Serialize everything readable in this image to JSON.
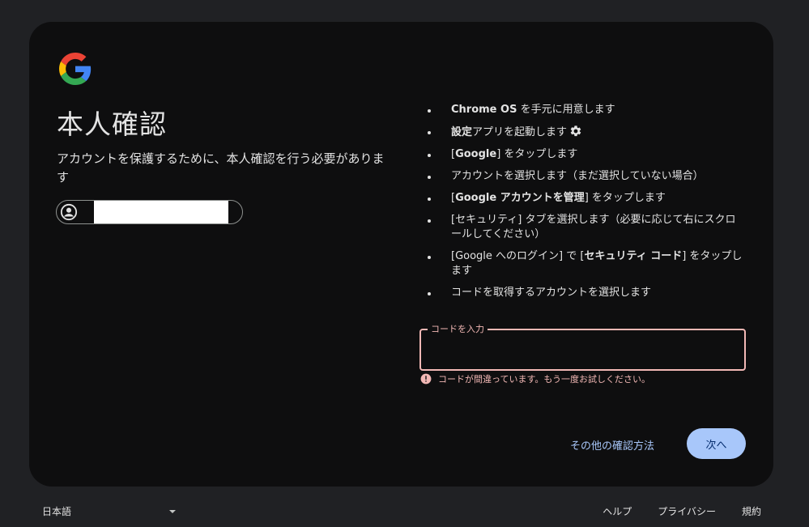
{
  "colors": {
    "page_bg": "#202124",
    "card_bg": "#0e0e0f",
    "error": "#f2b8b5",
    "accent": "#a8c7fa",
    "accent_text": "#062e6f"
  },
  "logo": {
    "icon": "google-g-logo-icon"
  },
  "heading": {
    "title": "本人確認",
    "subtitle": "アカウントを保護するために、本人確認を行う必要があります"
  },
  "account": {
    "icon": "account-circle-icon",
    "email": ""
  },
  "steps": [
    {
      "bold": "Chrome OS",
      "text": " を手元に用意します"
    },
    {
      "bold": "設定",
      "text": "アプリを起動します",
      "icon": "gear-icon"
    },
    {
      "pre": "[",
      "bold": "Google",
      "text": "] をタップします"
    },
    {
      "text": "アカウントを選択します（まだ選択していない場合）"
    },
    {
      "pre": "[",
      "bold": "Google アカウントを管理",
      "text": "] をタップします"
    },
    {
      "text": "[セキュリティ] タブを選択します（必要に応じて右にスクロールしてください）"
    },
    {
      "pre": "[Google へのログイン] で [",
      "bold": "セキュリティ コード",
      "text": "] をタップします"
    },
    {
      "text": "コードを取得するアカウントを選択します"
    }
  ],
  "code_field": {
    "label": "コードを入力",
    "value": "",
    "error": "コードが間違っています。もう一度お試しください。",
    "error_icon": "error-icon"
  },
  "actions": {
    "other_methods": "その他の確認方法",
    "next": "次へ"
  },
  "footer": {
    "language": "日本語",
    "links": [
      "ヘルプ",
      "プライバシー",
      "規約"
    ]
  }
}
